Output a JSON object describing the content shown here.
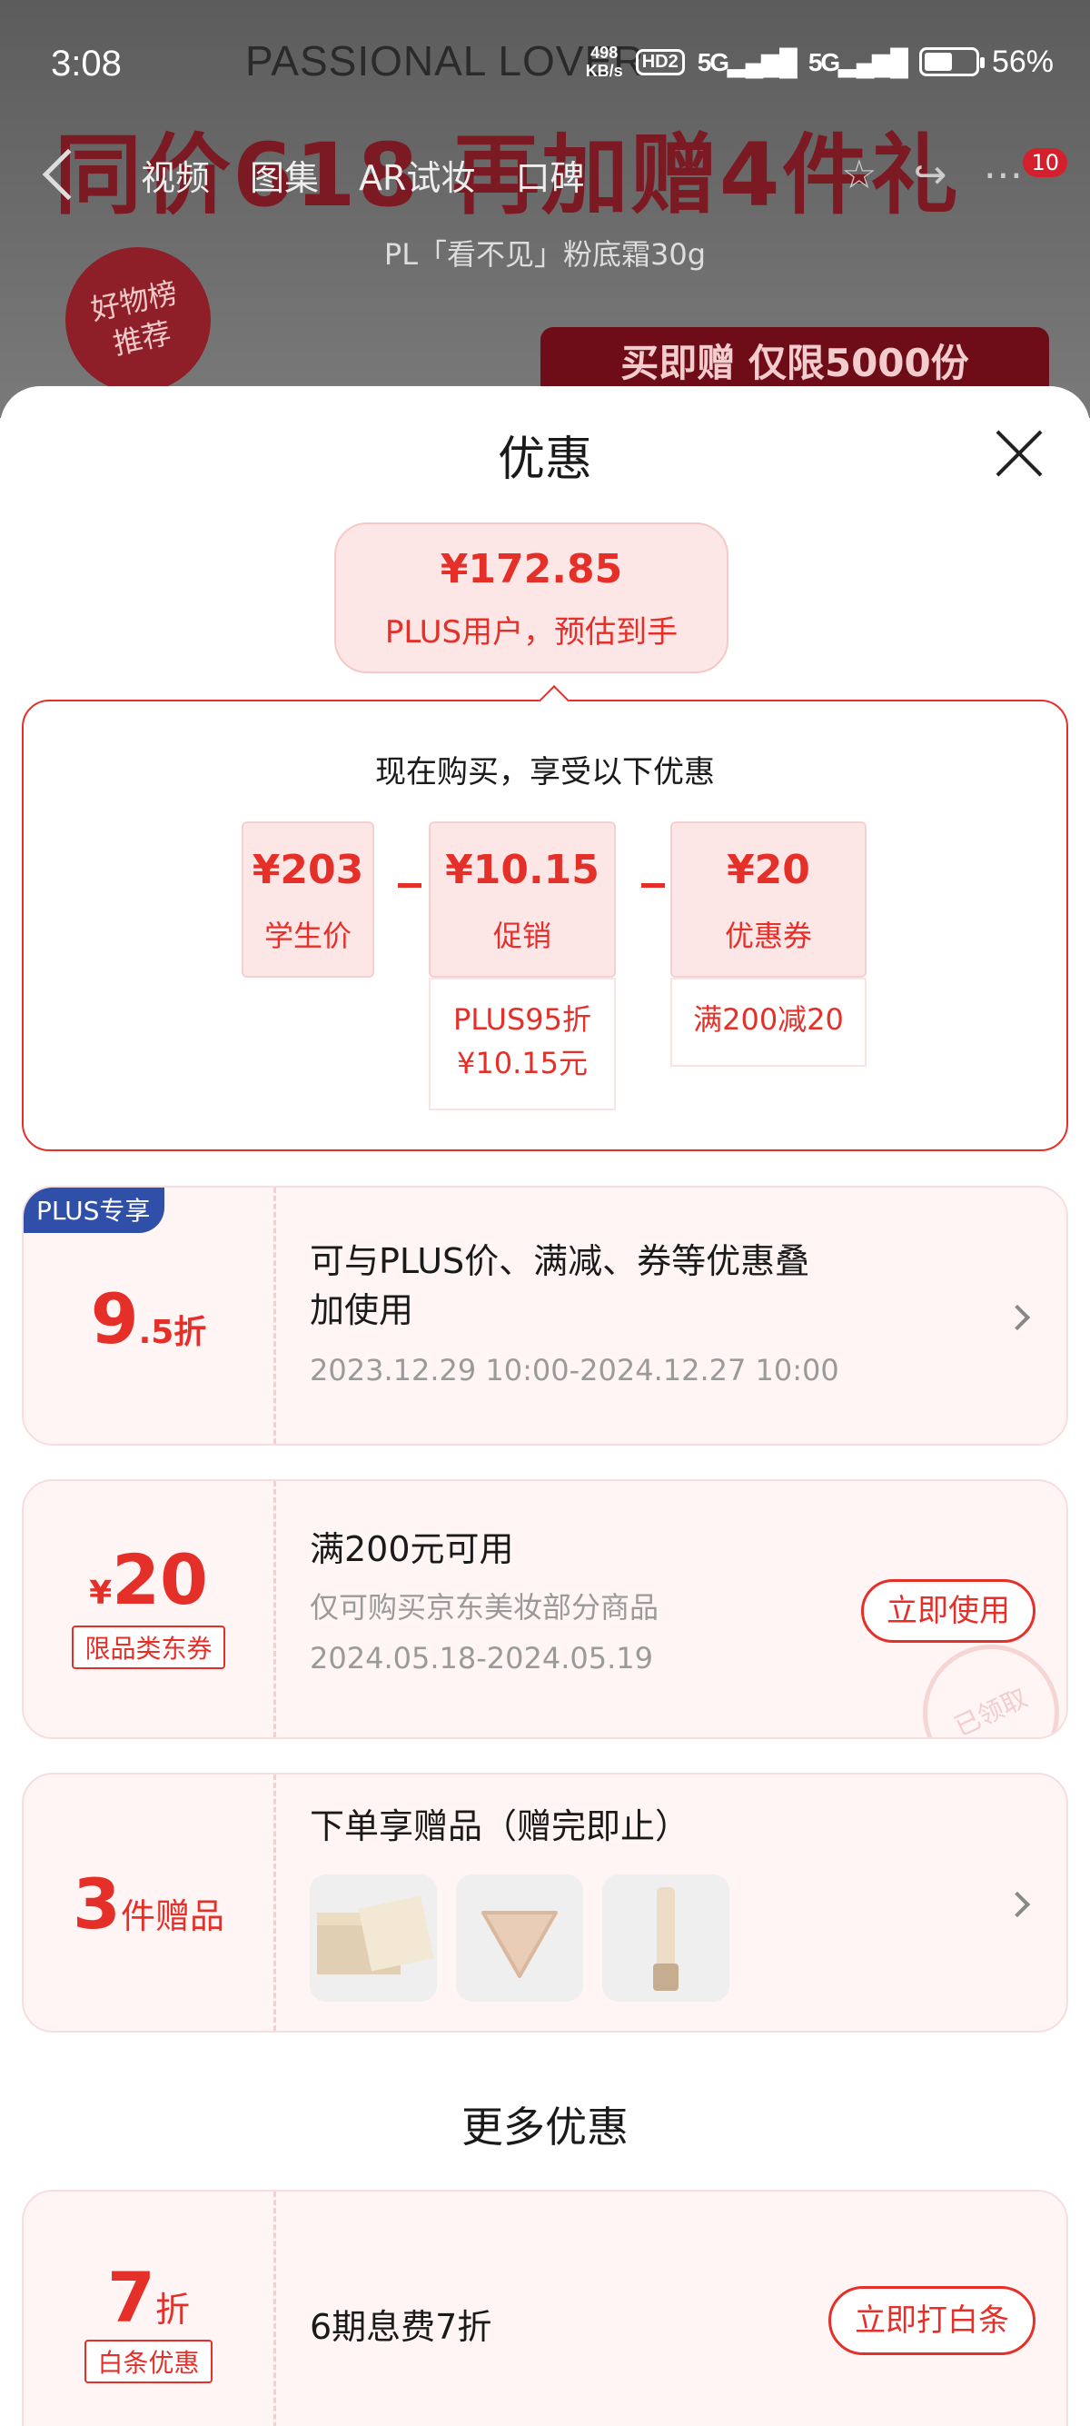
{
  "status_bar": {
    "time": "3:08",
    "net_speed_value": "498",
    "net_speed_unit": "KB/s",
    "hd_badge": "HD2",
    "signal_1": "5G",
    "signal_2": "5G",
    "battery_percent": "56%",
    "battery_level": 0.56
  },
  "background_page": {
    "brand": "PASSIONAL LOVER",
    "banner": "同价618 再加赠4件礼",
    "tabs": [
      "视频",
      "图集",
      "AR试妆",
      "口碑"
    ],
    "notification_count": "10",
    "product_title": "PL「看不见」粉底霜30g",
    "seal_line1": "好物榜",
    "seal_line2": "推荐",
    "buy_banner": "买即赠 仅限5000份"
  },
  "sheet": {
    "title": "优惠",
    "estimate": {
      "price": "¥172.85",
      "label": "PLUS用户，预估到手"
    },
    "breakdown": {
      "title": "现在购买，享受以下优惠",
      "items": [
        {
          "value": "¥203",
          "label": "学生价"
        },
        {
          "value": "¥10.15",
          "label": "促销",
          "note_line1": "PLUS95折",
          "note_line2": "¥10.15元"
        },
        {
          "value": "¥20",
          "label": "优惠券",
          "note_line1": "满200减20"
        }
      ]
    },
    "offers": [
      {
        "tag": "PLUS专享",
        "big": "9",
        "small": ".5折",
        "line1": "可与PLUS价、满减、券等优惠叠",
        "line2": "加使用",
        "meta": "2023.12.29 10:00-2024.12.27 10:00"
      },
      {
        "currency": "¥",
        "big": "20",
        "badge": "限品类东券",
        "line1": "满200元可用",
        "meta1": "仅可购买京东美妆部分商品",
        "meta2": "2024.05.18-2024.05.19",
        "button": "立即使用",
        "stamp": "已领取"
      },
      {
        "big": "3",
        "small": "件赠品",
        "line1": "下单享赠品（赠完即止）",
        "gifts": [
          "gift-box",
          "powder-puff",
          "cosmetic-tube"
        ]
      }
    ],
    "more_title": "更多优惠",
    "more_offers": [
      {
        "big": "7",
        "small": "折",
        "badge": "白条优惠",
        "line1": "6期息费7折",
        "button": "立即打白条"
      }
    ]
  },
  "colors": {
    "accent": "#e5302a",
    "chip_bg": "#fde6e6",
    "plus_blue": "#2f4fa8"
  }
}
